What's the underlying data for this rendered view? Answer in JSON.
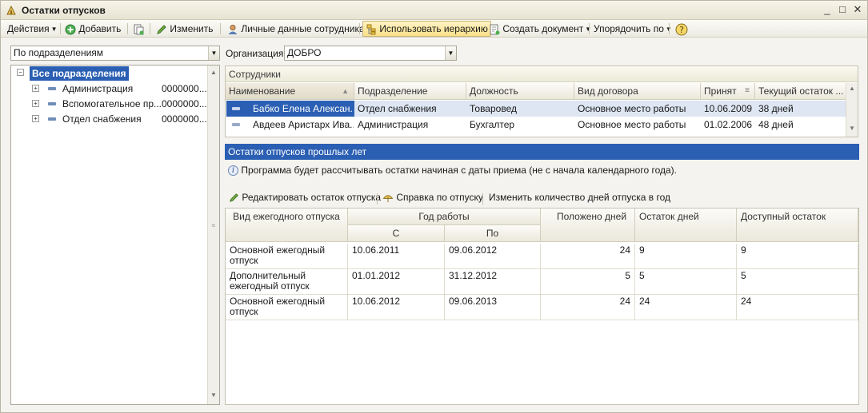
{
  "window": {
    "title": "Остатки отпусков"
  },
  "toolbar": {
    "actions": "Действия",
    "add": "Добавить",
    "edit": "Изменить",
    "personal_data": "Личные данные сотрудника",
    "use_hierarchy": "Использовать иерархию",
    "create_document": "Создать документ",
    "sort_by": "Упорядочить по"
  },
  "left": {
    "grouping_select": "По подразделениям",
    "tree": {
      "root": "Все подразделения",
      "items": [
        {
          "label": "Администрация",
          "code": "0000000..."
        },
        {
          "label": "Вспомогательное пр...",
          "code": "0000000..."
        },
        {
          "label": "Отдел снабжения",
          "code": "0000000..."
        }
      ]
    }
  },
  "org": {
    "label": "Организация:",
    "value": "ДОБРО"
  },
  "employees": {
    "title": "Сотрудники",
    "columns": [
      "Наименование",
      "Подразделение",
      "Должность",
      "Вид договора",
      "Принят",
      "Текущий остаток ..."
    ],
    "rows": [
      {
        "name": "Бабко Елена Алексан...",
        "dept": "Отдел снабжения",
        "position": "Товаровед",
        "contract": "Основное место работы",
        "hired": "10.06.2009",
        "balance": "38 дней"
      },
      {
        "name": "Авдеев Аристарх Ива...",
        "dept": "Администрация",
        "position": "Бухгалтер",
        "contract": "Основное место работы",
        "hired": "01.02.2006",
        "balance": "48 дней"
      }
    ]
  },
  "past": {
    "title": "Остатки отпусков прошлых лет",
    "info": "Программа будет рассчитывать остатки начиная с даты приема (не с начала календарного года).",
    "actions": {
      "edit_balance": "Редактировать остаток отпуска",
      "help": "Справка по отпуску",
      "change_days": "Изменить количество дней отпуска в год"
    },
    "columns": {
      "type": "Вид ежегодного отпуска",
      "year": "Год работы",
      "from": "С",
      "to": "По",
      "entitled": "Положено дней",
      "remaining": "Остаток дней",
      "available": "Доступный остаток"
    },
    "rows": [
      {
        "type": "Основной ежегодный отпуск",
        "from": "10.06.2011",
        "to": "09.06.2012",
        "entitled": "24",
        "remaining": "9",
        "available": "9"
      },
      {
        "type": "Дополнительный ежегодный отпуск",
        "from": "01.01.2012",
        "to": "31.12.2012",
        "entitled": "5",
        "remaining": "5",
        "available": "5"
      },
      {
        "type": "Основной ежегодный отпуск",
        "from": "10.06.2012",
        "to": "09.06.2013",
        "entitled": "24",
        "remaining": "24",
        "available": "24"
      }
    ]
  }
}
